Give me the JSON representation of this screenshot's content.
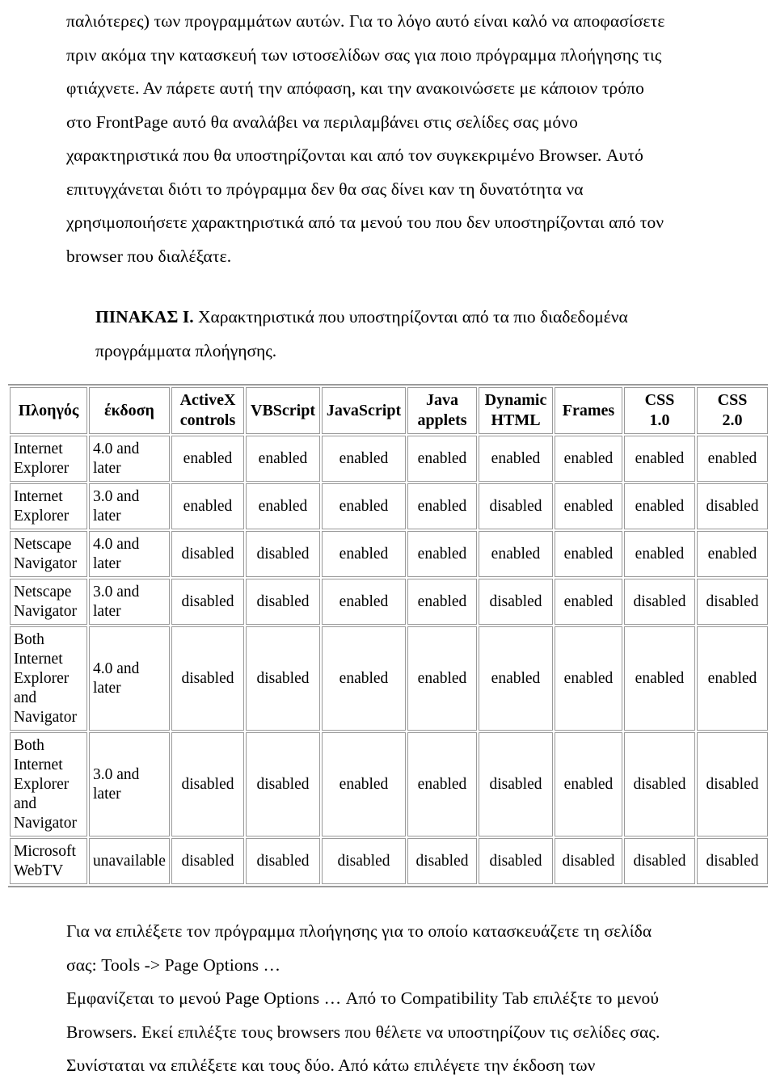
{
  "document": {
    "language": "el",
    "top_paragraph_lines": [
      "παλιότερες) των προγραμμάτων αυτών. Για το λόγο αυτό είναι καλό να αποφασίσετε",
      "πριν ακόμα την κατασκευή των ιστοσελίδων σας για ποιο πρόγραμμα πλοήγησης τις",
      "φτιάχνετε. Αν πάρετε αυτή την απόφαση, και την ανακοινώσετε με κάποιον τρόπο",
      "στο FrontPage αυτό θα αναλάβει να περιλαμβάνει στις σελίδες σας μόνο",
      "χαρακτηριστικά που θα υποστηρίζονται και από τον συγκεκριμένο Browser. Αυτό",
      "επιτυγχάνεται διότι το πρόγραμμα δεν θα σας δίνει καν τη δυνατότητα να",
      "χρησιμοποιήσετε χαρακτηριστικά από τα μενού του που δεν υποστηρίζονται από τον",
      "browser που διαλέξατε."
    ],
    "table_caption": {
      "label": "ΠΙΝΑΚΑΣ I.",
      "text": " Χαρακτηριστικά που υποστηρίζονται από τα πιο διαδεδομένα",
      "line2": "προγράμματα πλοήγησης."
    },
    "bottom_paragraph_lines": [
      "Για να επιλέξετε τον πρόγραμμα πλοήγησης για το οποίο κατασκευάζετε τη σελίδα",
      "σας: Tools -> Page Options …",
      "Εμφανίζεται το μενού Page Options … Από το Compatibility Tab επιλέξτε το μενού",
      "Browsers. Εκεί επιλέξτε τους browsers που θέλετε να υποστηρίζουν τις σελίδες σας.",
      "Συνίσταται να επιλέξετε και τους δύο. Από κάτω επιλέγετε την έκδοση των"
    ]
  },
  "chart_data": {
    "type": "table",
    "title": "ΠΙΝΑΚΑΣ I. Χαρακτηριστικά που υποστηρίζονται από τα πιο διαδεδομένα προγράμματα πλοήγησης.",
    "headers": [
      "Πλοηγός",
      "έκδοση",
      "ActiveX controls",
      "VBScript",
      "JavaScript",
      "Java applets",
      "Dynamic HTML",
      "Frames",
      "CSS 1.0",
      "CSS 2.0"
    ],
    "headers_multiline": [
      [
        "Πλοηγός"
      ],
      [
        "έκδοση"
      ],
      [
        "ActiveX",
        "controls"
      ],
      [
        "VBScript"
      ],
      [
        "JavaScript"
      ],
      [
        "Java",
        "applets"
      ],
      [
        "Dynamic",
        "HTML"
      ],
      [
        "Frames"
      ],
      [
        "CSS",
        "1.0"
      ],
      [
        "CSS",
        "2.0"
      ]
    ],
    "rows": [
      {
        "browser": "Internet Explorer",
        "browser_lines": [
          "Internet",
          "Explorer"
        ],
        "version": "4.0 and later",
        "version_lines": [
          "4.0 and",
          "later"
        ],
        "values": [
          "enabled",
          "enabled",
          "enabled",
          "enabled",
          "enabled",
          "enabled",
          "enabled",
          "enabled"
        ]
      },
      {
        "browser": "Internet Explorer",
        "browser_lines": [
          "Internet",
          "Explorer"
        ],
        "version": "3.0 and later",
        "version_lines": [
          "3.0 and",
          "later"
        ],
        "values": [
          "enabled",
          "enabled",
          "enabled",
          "enabled",
          "disabled",
          "enabled",
          "enabled",
          "disabled"
        ]
      },
      {
        "browser": "Netscape Navigator",
        "browser_lines": [
          "Netscape",
          "Navigator"
        ],
        "version": "4.0 and later",
        "version_lines": [
          "4.0 and",
          "later"
        ],
        "values": [
          "disabled",
          "disabled",
          "enabled",
          "enabled",
          "enabled",
          "enabled",
          "enabled",
          "enabled"
        ]
      },
      {
        "browser": "Netscape Navigator",
        "browser_lines": [
          "Netscape",
          "Navigator"
        ],
        "version": "3.0 and later",
        "version_lines": [
          "3.0 and",
          "later"
        ],
        "values": [
          "disabled",
          "disabled",
          "enabled",
          "enabled",
          "disabled",
          "enabled",
          "disabled",
          "disabled"
        ]
      },
      {
        "browser": "Both Internet Explorer and Navigator",
        "browser_lines": [
          "Both",
          "Internet",
          "Explorer",
          "and",
          "Navigator"
        ],
        "version": "4.0 and later",
        "version_lines": [
          "4.0 and",
          "later"
        ],
        "values": [
          "disabled",
          "disabled",
          "enabled",
          "enabled",
          "enabled",
          "enabled",
          "enabled",
          "enabled"
        ]
      },
      {
        "browser": "Both Internet Explorer and Navigator",
        "browser_lines": [
          "Both",
          "Internet",
          "Explorer",
          "and",
          "Navigator"
        ],
        "version": "3.0 and later",
        "version_lines": [
          "3.0 and",
          "later"
        ],
        "values": [
          "disabled",
          "disabled",
          "enabled",
          "enabled",
          "disabled",
          "enabled",
          "disabled",
          "disabled"
        ]
      },
      {
        "browser": "Microsoft WebTV",
        "browser_lines": [
          "Microsoft",
          "WebTV"
        ],
        "version": "unavailable",
        "version_lines": [
          "unavailable"
        ],
        "values": [
          "disabled",
          "disabled",
          "disabled",
          "disabled",
          "disabled",
          "disabled",
          "disabled",
          "disabled"
        ]
      }
    ],
    "legend": [
      "enabled",
      "disabled",
      "unavailable"
    ],
    "grid": true
  }
}
